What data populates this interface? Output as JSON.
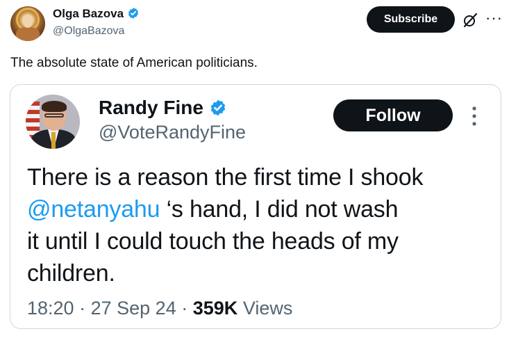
{
  "outer_post": {
    "author_name": "Olga Bazova",
    "author_handle": "@OlgaBazova",
    "subscribe_label": "Subscribe",
    "more_glyph": "···",
    "text": "The absolute state of American politicians."
  },
  "quoted_post": {
    "author_name": "Randy Fine",
    "author_handle": "@VoteRandyFine",
    "follow_label": "Follow",
    "text_line1": "There is a reason the first time I shook",
    "mention": "@netanyahu",
    "text_line2_rest": " ‘s hand, I did not wash",
    "text_line3": "it until I could touch the heads of my",
    "text_line4": "children.",
    "time": "18:20",
    "separator": "·",
    "date": "27 Sep 24",
    "views_count": "359K",
    "views_label": "Views"
  },
  "colors": {
    "verified_blue": "#1d9bf0",
    "button_black": "#0f1419",
    "secondary_text": "#536471",
    "card_border": "#cfd9de"
  },
  "icons": [
    "verified-badge-icon",
    "grok-icon",
    "more-options-icon",
    "kebab-menu-icon"
  ]
}
